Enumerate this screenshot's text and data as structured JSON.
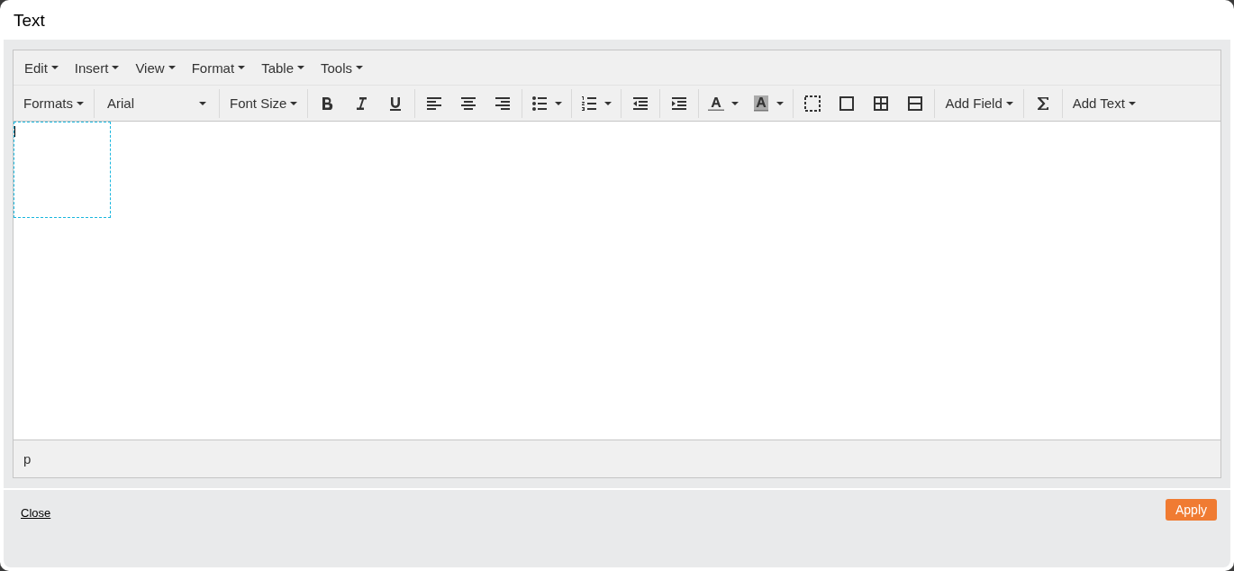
{
  "window": {
    "title": "Text"
  },
  "menubar": [
    {
      "label": "Edit"
    },
    {
      "label": "Insert"
    },
    {
      "label": "View"
    },
    {
      "label": "Format"
    },
    {
      "label": "Table"
    },
    {
      "label": "Tools"
    }
  ],
  "toolbar": [
    {
      "kind": "dropdown",
      "label": "Formats"
    },
    {
      "kind": "select",
      "value": "Arial"
    },
    {
      "kind": "dropdown",
      "label": "Font Size"
    },
    {
      "kind": "icons"
    },
    {
      "kind": "icons"
    },
    {
      "kind": "icons"
    },
    {
      "kind": "icons"
    },
    {
      "kind": "icons"
    },
    {
      "kind": "icons"
    },
    {
      "kind": "icons"
    },
    {
      "kind": "icons"
    },
    {
      "kind": "dropdown",
      "label": "Add Field"
    },
    {
      "kind": "icons"
    },
    {
      "kind": "dropdown",
      "label": "Add Text"
    }
  ],
  "status_bar": {
    "path": "p"
  },
  "footer": {
    "close": "Close",
    "apply": "Apply"
  }
}
